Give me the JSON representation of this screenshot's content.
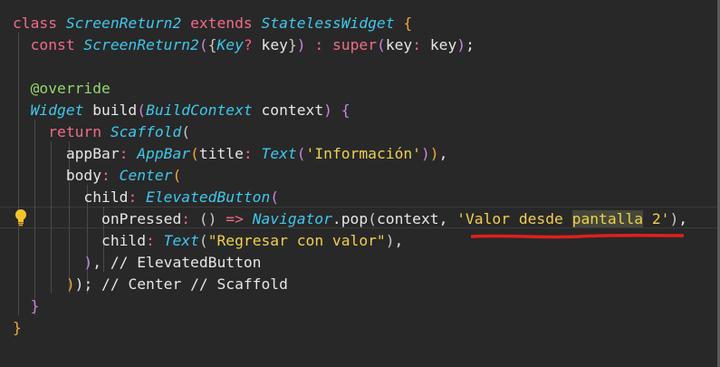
{
  "editor": {
    "language": "dart",
    "lines": [
      [
        {
          "t": "class ",
          "c": "k"
        },
        {
          "t": "ScreenReturn2",
          "c": "t"
        },
        {
          "t": " extends ",
          "c": "k"
        },
        {
          "t": "StatelessWidget",
          "c": "t"
        },
        {
          "t": " {",
          "c": "b"
        }
      ],
      [
        {
          "t": "  const ",
          "c": "k"
        },
        {
          "t": "ScreenReturn2",
          "c": "t"
        },
        {
          "t": "(",
          "c": "pu"
        },
        {
          "t": "{",
          "c": "c"
        },
        {
          "t": "Key",
          "c": "t"
        },
        {
          "t": "?",
          "c": "q"
        },
        {
          "t": " key",
          "c": "p"
        },
        {
          "t": "}",
          "c": "c"
        },
        {
          "t": ")",
          "c": "pu"
        },
        {
          "t": " : ",
          "c": "k"
        },
        {
          "t": "super",
          "c": "k"
        },
        {
          "t": "(",
          "c": "pu"
        },
        {
          "t": "key",
          "c": "p"
        },
        {
          "t": ": ",
          "c": "k"
        },
        {
          "t": "key",
          "c": "p"
        },
        {
          "t": ")",
          "c": "pu"
        },
        {
          "t": ";",
          "c": "p"
        }
      ],
      [],
      [
        {
          "t": "  @override",
          "c": "m"
        }
      ],
      [
        {
          "t": "  Widget",
          "c": "t"
        },
        {
          "t": " build",
          "c": "p"
        },
        {
          "t": "(",
          "c": "pu"
        },
        {
          "t": "BuildContext",
          "c": "t"
        },
        {
          "t": " context",
          "c": "p"
        },
        {
          "t": ")",
          "c": "pu"
        },
        {
          "t": " {",
          "c": "pu"
        }
      ],
      [
        {
          "t": "    return ",
          "c": "k"
        },
        {
          "t": "Scaffold",
          "c": "t"
        },
        {
          "t": "(",
          "c": "c"
        }
      ],
      [
        {
          "t": "      appBar",
          "c": "p"
        },
        {
          "t": ": ",
          "c": "k"
        },
        {
          "t": "AppBar",
          "c": "t"
        },
        {
          "t": "(",
          "c": "b"
        },
        {
          "t": "title",
          "c": "p"
        },
        {
          "t": ": ",
          "c": "k"
        },
        {
          "t": "Text",
          "c": "t"
        },
        {
          "t": "(",
          "c": "pu"
        },
        {
          "t": "'Información'",
          "c": "s"
        },
        {
          "t": ")",
          "c": "pu"
        },
        {
          "t": ")",
          "c": "b"
        },
        {
          "t": ",",
          "c": "p"
        }
      ],
      [
        {
          "t": "      body",
          "c": "p"
        },
        {
          "t": ": ",
          "c": "k"
        },
        {
          "t": "Center",
          "c": "t"
        },
        {
          "t": "(",
          "c": "b"
        }
      ],
      [
        {
          "t": "        child",
          "c": "p"
        },
        {
          "t": ": ",
          "c": "k"
        },
        {
          "t": "ElevatedButton",
          "c": "t"
        },
        {
          "t": "(",
          "c": "pu"
        }
      ],
      [
        {
          "t": "          onPressed",
          "c": "p"
        },
        {
          "t": ": ",
          "c": "k"
        },
        {
          "t": "()",
          "c": "c"
        },
        {
          "t": " => ",
          "c": "k"
        },
        {
          "t": "Navigator",
          "c": "t"
        },
        {
          "t": ".",
          "c": "p"
        },
        {
          "t": "pop",
          "c": "p"
        },
        {
          "t": "(",
          "c": "c"
        },
        {
          "t": "context",
          "c": "p"
        },
        {
          "t": ", ",
          "c": "p"
        },
        {
          "t": "'Valor desde ",
          "c": "s"
        },
        {
          "t": "pantalla",
          "c": "s",
          "hl": true
        },
        {
          "t": " 2'",
          "c": "s"
        },
        {
          "t": ")",
          "c": "c"
        },
        {
          "t": ",",
          "c": "p"
        }
      ],
      [
        {
          "t": "          child",
          "c": "p"
        },
        {
          "t": ": ",
          "c": "k"
        },
        {
          "t": "Text",
          "c": "t"
        },
        {
          "t": "(",
          "c": "c"
        },
        {
          "t": "\"Regresar con valor\"",
          "c": "s"
        },
        {
          "t": ")",
          "c": "c"
        },
        {
          "t": ",",
          "c": "p"
        }
      ],
      [
        {
          "t": "        ",
          "c": "p"
        },
        {
          "t": ")",
          "c": "pu"
        },
        {
          "t": ", // ElevatedButton",
          "c": "p"
        }
      ],
      [
        {
          "t": "      ",
          "c": "p"
        },
        {
          "t": ")",
          "c": "b"
        },
        {
          "t": "); // Center // Scaffold",
          "c": "p"
        }
      ],
      [
        {
          "t": "  ",
          "c": "p"
        },
        {
          "t": "}",
          "c": "pu"
        }
      ],
      [
        {
          "t": "}",
          "c": "b"
        }
      ]
    ]
  },
  "colors": {
    "background": "#282828",
    "keyword": "#f16b8a",
    "type": "#3ec7ec",
    "string": "#f0d04d",
    "annotation": "#96d56b",
    "red_underline": "#e0201e"
  },
  "icons": {
    "lightbulb": "lightbulb-icon"
  }
}
